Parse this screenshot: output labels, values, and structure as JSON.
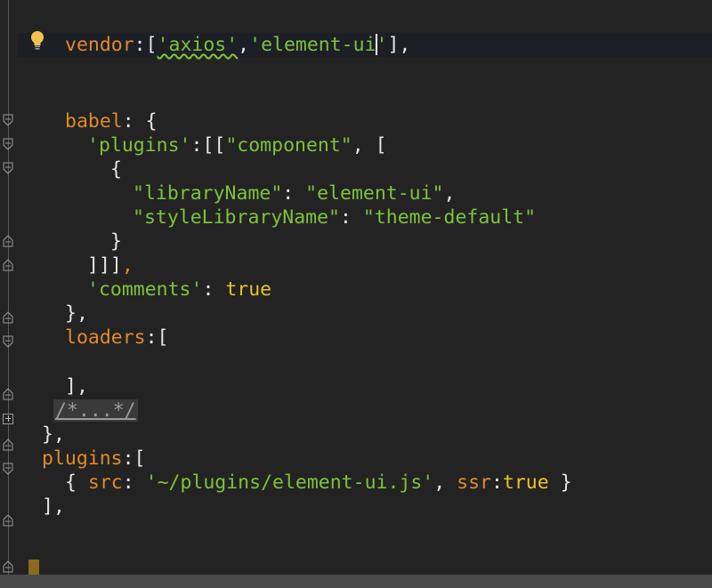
{
  "editor": {
    "lines": [
      {
        "id": "vendor",
        "tokens": [
          {
            "t": "vendor",
            "c": "orange"
          },
          {
            "t": ":[",
            "c": "white"
          },
          {
            "t": "'axios'",
            "c": "green",
            "squiggle": true
          },
          {
            "t": ",",
            "c": "white"
          },
          {
            "t": "'element-ui",
            "c": "green"
          },
          {
            "t": "'",
            "c": "green",
            "caret_before": true
          },
          {
            "t": "],",
            "c": "white"
          }
        ]
      },
      {
        "id": "babel",
        "tokens": [
          {
            "t": "babel",
            "c": "orange"
          },
          {
            "t": ": {",
            "c": "white"
          }
        ]
      },
      {
        "id": "plugins-key",
        "tokens": [
          {
            "t": "'plugins'",
            "c": "green"
          },
          {
            "t": ":[[",
            "c": "white"
          },
          {
            "t": "\"component\"",
            "c": "green"
          },
          {
            "t": ", [",
            "c": "white"
          }
        ]
      },
      {
        "id": "open-brace",
        "tokens": [
          {
            "t": "{",
            "c": "white"
          }
        ]
      },
      {
        "id": "library-name",
        "tokens": [
          {
            "t": "\"libraryName\"",
            "c": "green"
          },
          {
            "t": ": ",
            "c": "white"
          },
          {
            "t": "\"element-ui\"",
            "c": "green"
          },
          {
            "t": ",",
            "c": "white"
          }
        ]
      },
      {
        "id": "style-library-name",
        "tokens": [
          {
            "t": "\"styleLibraryName\"",
            "c": "green"
          },
          {
            "t": ": ",
            "c": "white"
          },
          {
            "t": "\"theme-default\"",
            "c": "green"
          }
        ]
      },
      {
        "id": "close-brace",
        "tokens": [
          {
            "t": "}",
            "c": "white"
          }
        ]
      },
      {
        "id": "close-brackets",
        "tokens": [
          {
            "t": "]]]",
            "c": "white"
          },
          {
            "t": ",",
            "c": "orange"
          }
        ]
      },
      {
        "id": "comments",
        "tokens": [
          {
            "t": "'comments'",
            "c": "green"
          },
          {
            "t": ": ",
            "c": "white"
          },
          {
            "t": "true",
            "c": "yellow"
          }
        ]
      },
      {
        "id": "close-babel",
        "tokens": [
          {
            "t": "},",
            "c": "white"
          }
        ]
      },
      {
        "id": "loaders",
        "tokens": [
          {
            "t": "loaders",
            "c": "orange"
          },
          {
            "t": ":[",
            "c": "white"
          }
        ]
      },
      {
        "id": "close-loaders",
        "tokens": [
          {
            "t": "],",
            "c": "white"
          }
        ]
      },
      {
        "id": "folded-comment",
        "tokens": [
          {
            "t": "/*...*/",
            "c": "folded"
          }
        ]
      },
      {
        "id": "close-build",
        "tokens": [
          {
            "t": "},",
            "c": "white"
          }
        ]
      },
      {
        "id": "plugins",
        "tokens": [
          {
            "t": "plugins",
            "c": "orange"
          },
          {
            "t": ":[",
            "c": "white"
          }
        ]
      },
      {
        "id": "plugin-entry",
        "tokens": [
          {
            "t": "{ ",
            "c": "white"
          },
          {
            "t": "src",
            "c": "orange"
          },
          {
            "t": ": ",
            "c": "white"
          },
          {
            "t": "'~/plugins/element-ui.js'",
            "c": "green"
          },
          {
            "t": ", ",
            "c": "white"
          },
          {
            "t": "ssr",
            "c": "orange"
          },
          {
            "t": ":",
            "c": "white"
          },
          {
            "t": "true",
            "c": "yellow"
          },
          {
            "t": " }",
            "c": "white"
          }
        ]
      },
      {
        "id": "close-plugins",
        "tokens": [
          {
            "t": "],",
            "c": "white"
          }
        ]
      }
    ]
  },
  "icons": {
    "intention": "lightbulb-icon",
    "fold": "fold-arrow-icon",
    "expand": "expand-fold-icon"
  },
  "colors": {
    "background": "#232323",
    "current_line": "#1c1f26",
    "keyword_orange": "#e08a2b",
    "string_green": "#7ec23a",
    "boolean_yellow": "#e8c227"
  }
}
